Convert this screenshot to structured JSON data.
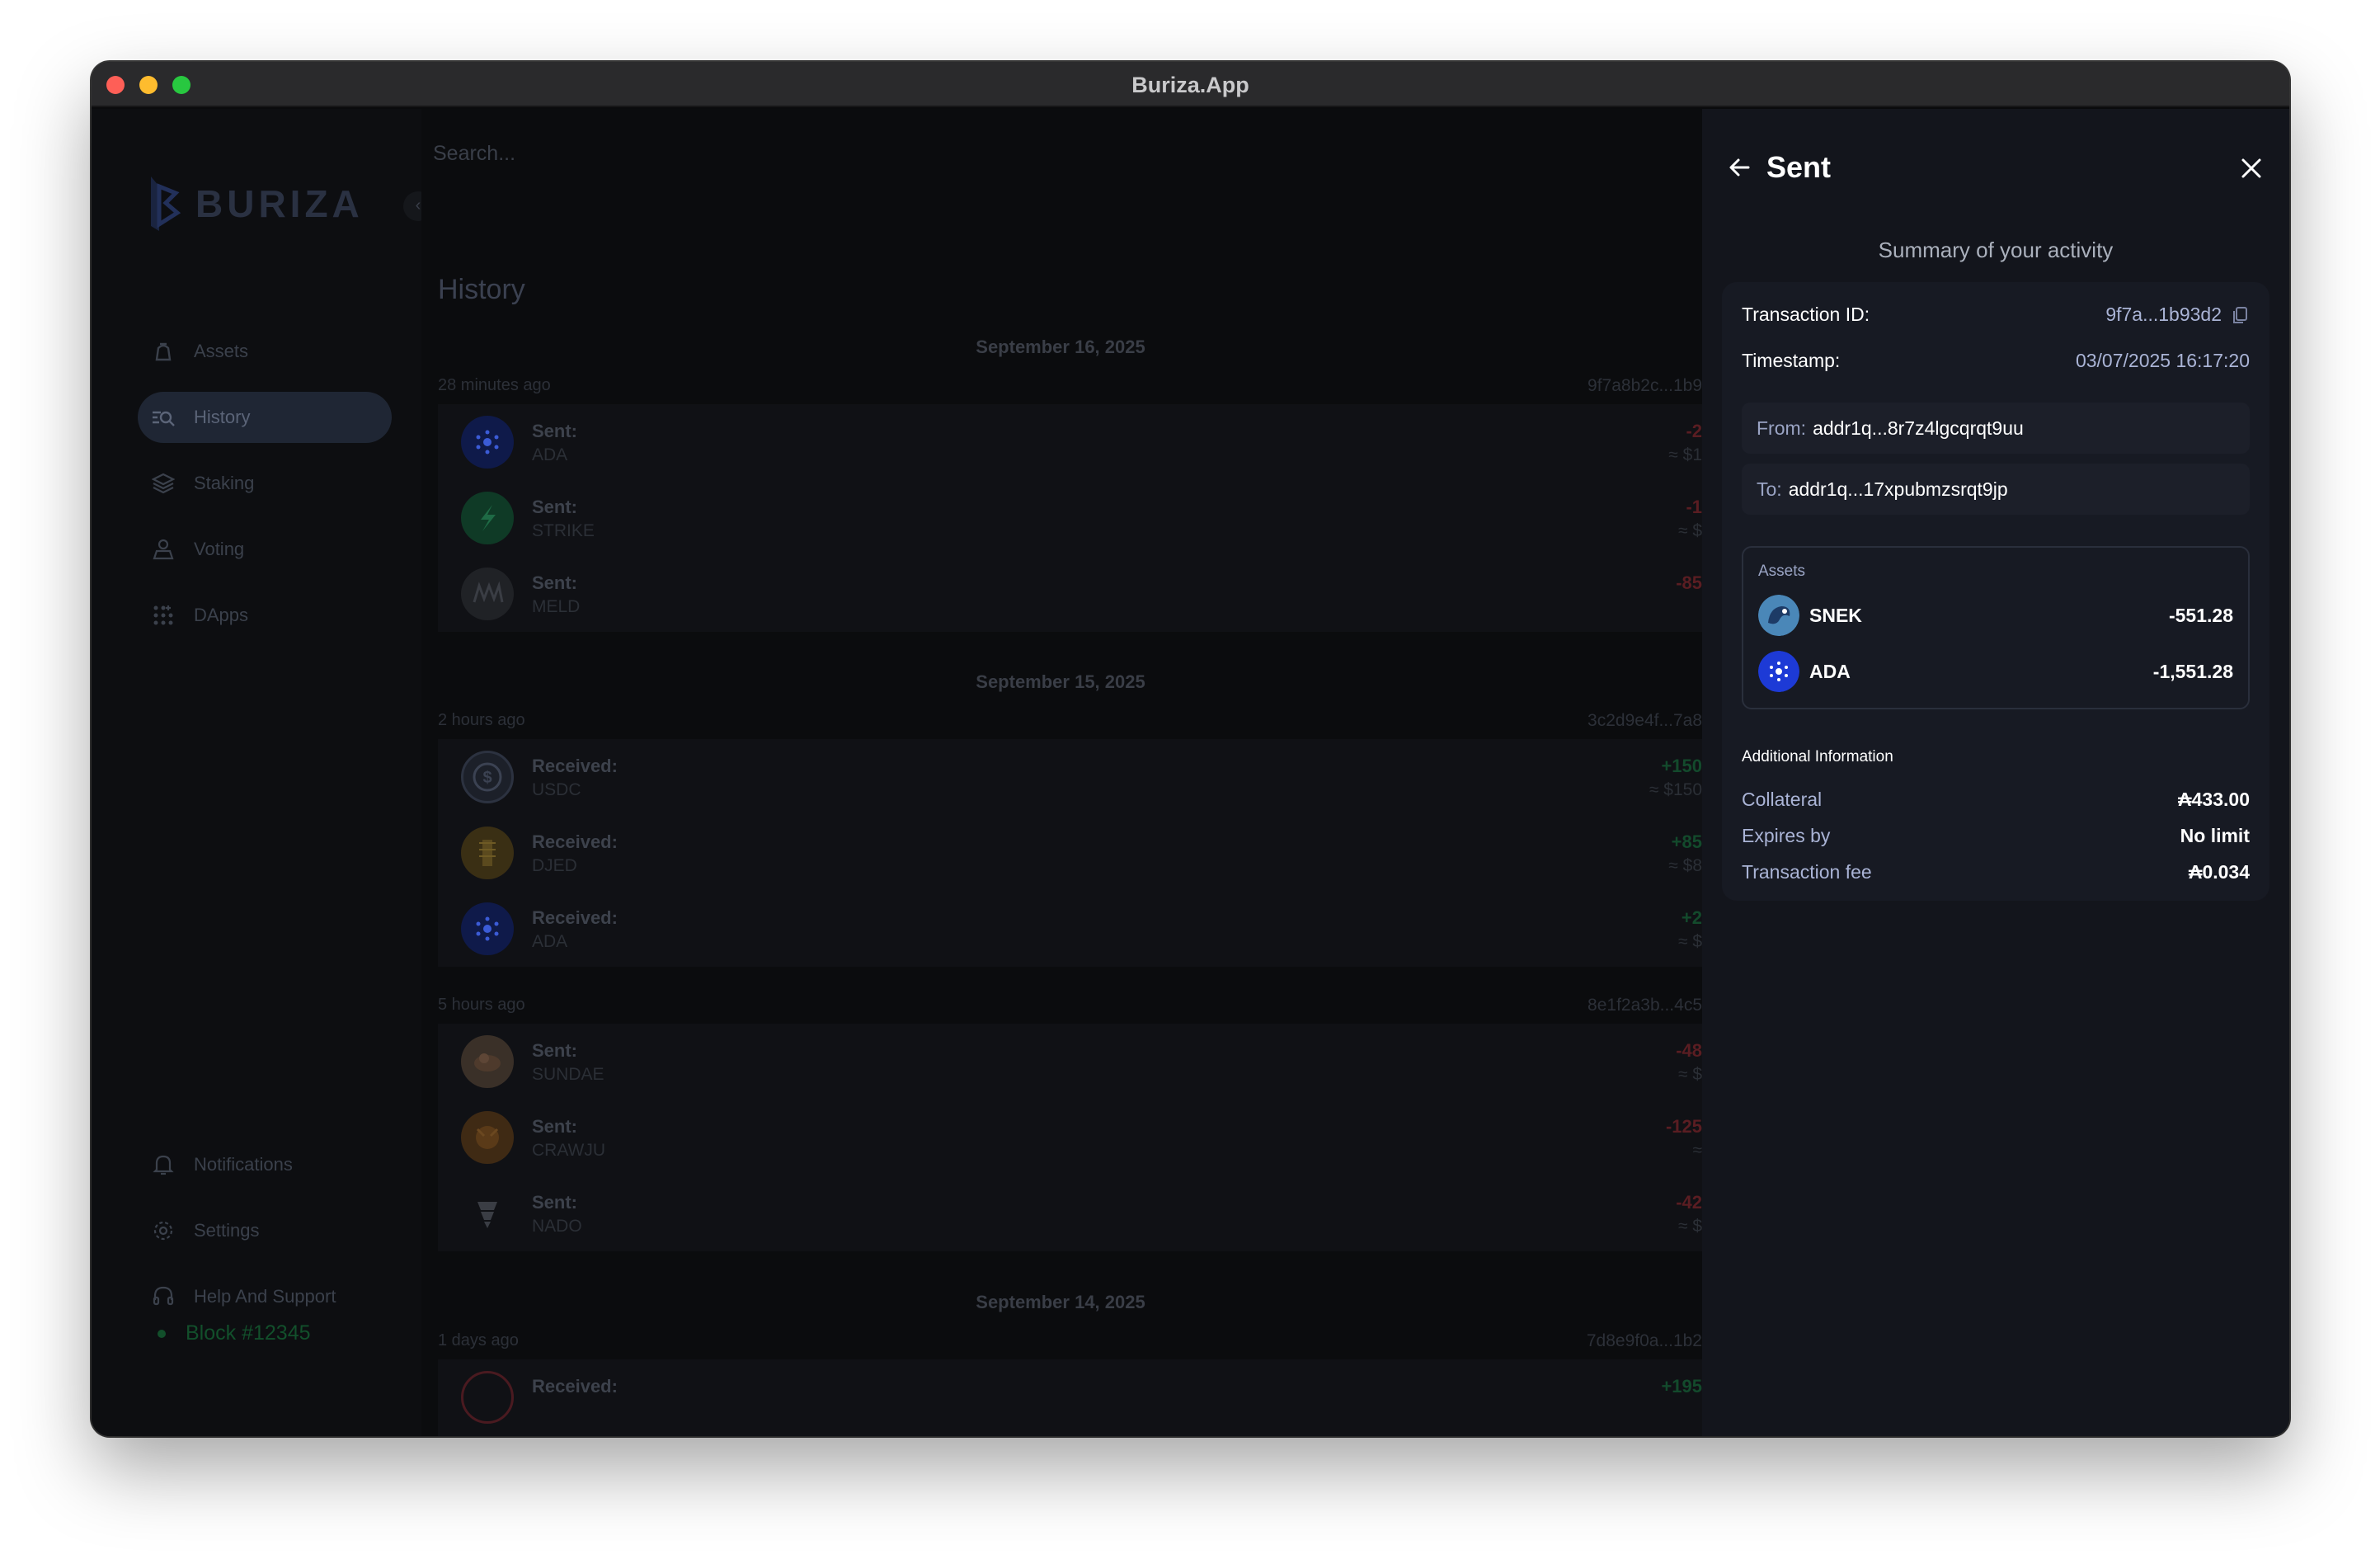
{
  "window": {
    "title": "Buriza.App"
  },
  "sidebar": {
    "logo_text": "BURIZA",
    "collapse_icon": "‹",
    "nav_top": [
      {
        "label": "Assets",
        "icon": "assets-icon"
      },
      {
        "label": "History",
        "icon": "history-icon",
        "active": true
      },
      {
        "label": "Staking",
        "icon": "staking-icon"
      },
      {
        "label": "Voting",
        "icon": "voting-icon"
      },
      {
        "label": "DApps",
        "icon": "dapps-icon"
      }
    ],
    "nav_bottom": [
      {
        "label": "Notifications",
        "icon": "bell-icon"
      },
      {
        "label": "Settings",
        "icon": "gear-icon"
      },
      {
        "label": "Help And Support",
        "icon": "headset-icon"
      }
    ],
    "block_status": "Block #12345"
  },
  "main": {
    "search_placeholder": "Search...",
    "title": "History",
    "days": [
      {
        "date": "September 16, 2025",
        "groups": [
          {
            "time_ago": "28 minutes ago",
            "hash": "9f7a8b2c...1b9",
            "items": [
              {
                "label": "Sent:",
                "symbol": "ADA",
                "amount": "-2",
                "fiat": "≈ $1",
                "kind": "neg",
                "icon": "ada-icon"
              },
              {
                "label": "Sent:",
                "symbol": "STRIKE",
                "amount": "-1",
                "fiat": "≈ $",
                "kind": "neg",
                "icon": "strike-icon"
              },
              {
                "label": "Sent:",
                "symbol": "MELD",
                "amount": "-85",
                "fiat": "",
                "kind": "neg",
                "icon": "meld-icon"
              }
            ]
          }
        ]
      },
      {
        "date": "September 15, 2025",
        "groups": [
          {
            "time_ago": "2 hours ago",
            "hash": "3c2d9e4f...7a8",
            "items": [
              {
                "label": "Received:",
                "symbol": "USDC",
                "amount": "+150",
                "fiat": "≈ $150",
                "kind": "pos",
                "icon": "usdc-icon"
              },
              {
                "label": "Received:",
                "symbol": "DJED",
                "amount": "+85",
                "fiat": "≈ $8",
                "kind": "pos",
                "icon": "djed-icon"
              },
              {
                "label": "Received:",
                "symbol": "ADA",
                "amount": "+2",
                "fiat": "≈ $",
                "kind": "pos",
                "icon": "ada-icon"
              }
            ]
          },
          {
            "time_ago": "5 hours ago",
            "hash": "8e1f2a3b...4c5",
            "items": [
              {
                "label": "Sent:",
                "symbol": "SUNDAE",
                "amount": "-48",
                "fiat": "≈ $",
                "kind": "neg",
                "icon": "sundae-icon"
              },
              {
                "label": "Sent:",
                "symbol": "CRAWJU",
                "amount": "-125",
                "fiat": "≈",
                "kind": "neg",
                "icon": "crawju-icon"
              },
              {
                "label": "Sent:",
                "symbol": "NADO",
                "amount": "-42",
                "fiat": "≈ $",
                "kind": "neg",
                "icon": "nado-icon"
              }
            ]
          }
        ]
      },
      {
        "date": "September 14, 2025",
        "groups": [
          {
            "time_ago": "1 days ago",
            "hash": "7d8e9f0a...1b2",
            "items": [
              {
                "label": "Received:",
                "symbol": "",
                "amount": "+195",
                "fiat": "",
                "kind": "pos",
                "icon": "token-icon"
              }
            ]
          }
        ]
      }
    ]
  },
  "panel": {
    "title": "Sent",
    "back_icon": "arrow-left-icon",
    "close_icon": "close-icon",
    "summary_title": "Summary of your activity",
    "transaction_id_label": "Transaction ID:",
    "transaction_id": "9f7a...1b93d2",
    "timestamp_label": "Timestamp:",
    "timestamp": "03/07/2025 16:17:20",
    "from_label": "From:",
    "from": "addr1q...8r7z4lgcqrqt9uu",
    "to_label": "To:",
    "to": "addr1q...17xpubmzsrqt9jp",
    "assets_label": "Assets",
    "assets": [
      {
        "name": "SNEK",
        "amount": "-551.28",
        "icon": "snek-icon"
      },
      {
        "name": "ADA",
        "amount": "-1,551.28",
        "icon": "ada-icon"
      }
    ],
    "additional_label": "Additional Information",
    "info": [
      {
        "label": "Collateral",
        "value": "₳433.00"
      },
      {
        "label": "Expires by",
        "value": "No limit"
      },
      {
        "label": "Transaction fee",
        "value": "₳0.034"
      }
    ]
  },
  "colors": {
    "accent": "#1f2634",
    "panel_bg": "#13151c",
    "card_bg": "#171a23",
    "link": "#aab4d6"
  }
}
